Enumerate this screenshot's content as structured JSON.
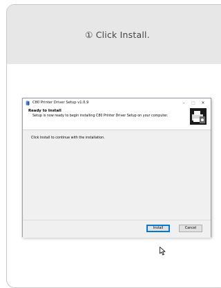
{
  "step": {
    "title": "① Click Install."
  },
  "window": {
    "title": "C80 Printer Driver Setup v1.0.9",
    "controls": {
      "minimize": "–",
      "maximize": "□",
      "close": "✕"
    },
    "header": {
      "title": "Ready to Install",
      "subtitle": "Setup is now ready to begin installing C80 Printer Driver Setup on your computer."
    },
    "body_text": "Click Install to continue with the installation.",
    "buttons": {
      "install": "Install",
      "cancel": "Cancel"
    }
  },
  "icons": [
    "app-icon",
    "printer-icon",
    "mouse-cursor-icon"
  ]
}
